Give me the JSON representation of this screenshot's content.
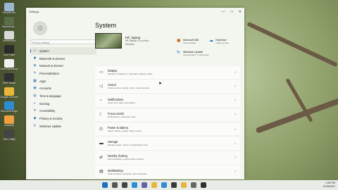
{
  "desktop": {
    "icons": [
      {
        "label": "Recycle Bin",
        "color": "#9bb6d1"
      },
      {
        "label": "Summerwi...",
        "color": "#5a6e48"
      },
      {
        "label": "Screenshot",
        "color": "#d9d9d9"
      },
      {
        "label": "Cool Paint",
        "color": "#2b2b2b"
      },
      {
        "label": "Cool PaintShop",
        "color": "#f0f0f0"
      },
      {
        "label": "OBS Studio",
        "color": "#303030"
      },
      {
        "label": "Google Chrome",
        "color": "#e8b53a"
      },
      {
        "label": "Microsoft Edge",
        "color": "#2e8bd6"
      },
      {
        "label": "Audacity",
        "color": "#f0a040"
      },
      {
        "label": "DDU Utility",
        "color": "#444444"
      }
    ]
  },
  "window": {
    "app_title": "Settings",
    "controls": [
      "—",
      "□",
      "✕"
    ]
  },
  "sidebar": {
    "search_placeholder": "Find a setting",
    "items": [
      {
        "label": "System",
        "icon": "monitor-icon",
        "glyph": "▭",
        "selected": true
      },
      {
        "label": "Bluetooth & devices",
        "icon": "bluetooth-icon",
        "glyph": "✱"
      },
      {
        "label": "Network & internet",
        "icon": "wifi-icon",
        "glyph": "◈"
      },
      {
        "label": "Personalization",
        "icon": "brush-icon",
        "glyph": "✎"
      },
      {
        "label": "Apps",
        "icon": "apps-icon",
        "glyph": "▦"
      },
      {
        "label": "Accounts",
        "icon": "person-icon",
        "glyph": "◉"
      },
      {
        "label": "Time & language",
        "icon": "globe-icon",
        "glyph": "◍"
      },
      {
        "label": "Gaming",
        "icon": "controller-icon",
        "glyph": "◐"
      },
      {
        "label": "Accessibility",
        "icon": "accessibility-icon",
        "glyph": "✦"
      },
      {
        "label": "Privacy & security",
        "icon": "shield-icon",
        "glyph": "◆"
      },
      {
        "label": "Windows Update",
        "icon": "update-icon",
        "glyph": "↻"
      }
    ]
  },
  "main": {
    "title": "System",
    "device": {
      "name": "HP_laptop",
      "model": "HP Laptop 17s-cr0xxx",
      "rename": "Rename"
    },
    "quick": [
      {
        "title": "Microsoft 365",
        "sub": "View benefits",
        "glyph": "▣",
        "color": "#d04a02"
      },
      {
        "title": "OneDrive",
        "sub": "• Back up files",
        "glyph": "☁",
        "color": "#1f6ec2"
      },
      {
        "title": "Windows Update",
        "sub": "Last checked: 1 minute ago",
        "glyph": "↻",
        "color": "#1f6ec2"
      }
    ],
    "cards": [
      {
        "title": "Display",
        "sub": "Monitors, brightness, night light, display profile",
        "icon": "display-icon",
        "glyph": "▭"
      },
      {
        "title": "Sound",
        "sub": "Volume levels, output, input, sound devices",
        "icon": "speaker-icon",
        "glyph": "◁"
      },
      {
        "title": "Notifications",
        "sub": "Alerts from apps and system",
        "icon": "bell-icon",
        "glyph": "◔"
      },
      {
        "title": "Focus assist",
        "sub": "Notifications, automatic rules",
        "icon": "moon-icon",
        "glyph": "☾"
      },
      {
        "title": "Power & battery",
        "sub": "Sleep, battery usage, battery saver",
        "icon": "power-icon",
        "glyph": "⏻"
      },
      {
        "title": "Storage",
        "sub": "Storage space, drives, configuration rules",
        "icon": "drive-icon",
        "glyph": "▬"
      },
      {
        "title": "Nearby sharing",
        "sub": "Discoverability, received files location",
        "icon": "share-icon",
        "glyph": "⇄"
      },
      {
        "title": "Multitasking",
        "sub": "Snap windows, desktops, task switching",
        "icon": "multitask-icon",
        "glyph": "▤"
      }
    ]
  },
  "taskbar": {
    "icons": [
      {
        "name": "start-icon",
        "color": "#1f6ec2"
      },
      {
        "name": "search-taskbar-icon",
        "color": "#555555"
      },
      {
        "name": "taskview-icon",
        "color": "#444444"
      },
      {
        "name": "widgets-icon",
        "color": "#2e8bd6"
      },
      {
        "name": "chat-icon",
        "color": "#6264a7"
      },
      {
        "name": "explorer-icon",
        "color": "#e8b53a"
      },
      {
        "name": "edge-icon",
        "color": "#2e8bd6"
      },
      {
        "name": "store-icon",
        "color": "#3a3a3a"
      },
      {
        "name": "chrome-icon",
        "color": "#e8b53a"
      },
      {
        "name": "settings-taskbar-icon",
        "color": "#666666"
      },
      {
        "name": "obs-icon",
        "color": "#303030"
      }
    ],
    "time": "4:52 PM",
    "date": "11/28/2021"
  }
}
